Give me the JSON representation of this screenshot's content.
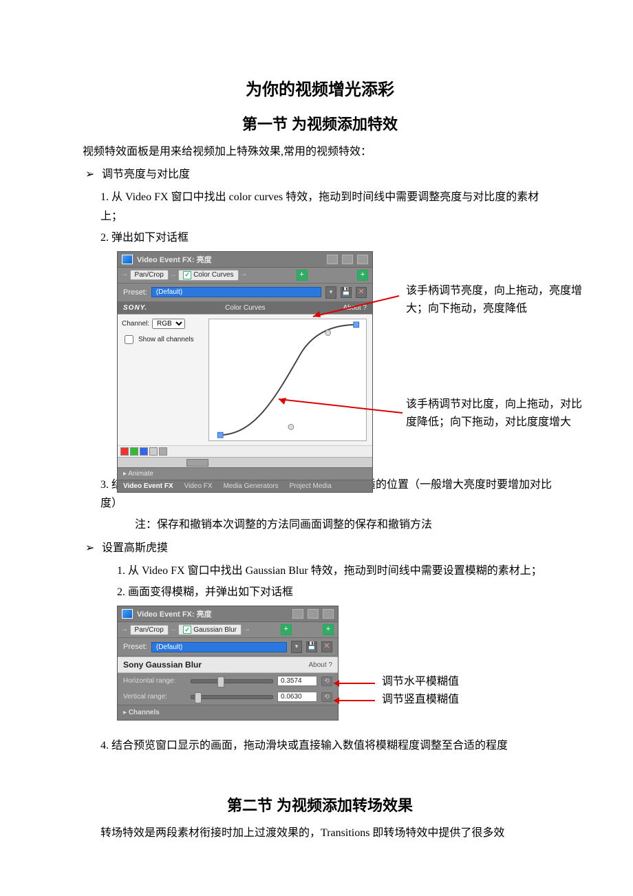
{
  "title": "为你的视频增光添彩",
  "section1": {
    "heading": "第一节  为视频添加特效",
    "intro": "视频特效面板是用来给视频加上特殊效果,常用的视频特效：",
    "bullet1": "调节亮度与对比度",
    "step1": "1. 从 Video FX 窗口中找出 color curves 特效，拖动到时间线中需要调整亮度与对比度的素材上；",
    "step2": "2. 弹出如下对话框",
    "step3": "3. 结合预览窗口显示的画面，将亮度与对比度调整至合适的位置（一般增大亮度时要增加对比度）",
    "note": "注：保存和撤销本次调整的方法同画面调整的保存和撤销方法",
    "bullet2": "设置高斯虎摸",
    "gb_step1": "1.    从 Video FX 窗口中找出 Gaussian Blur 特效，拖动到时间线中需要设置模糊的素材上；",
    "gb_step2": "2.    画面变得模糊，并弹出如下对话框",
    "step4": "4. 结合预览窗口显示的画面，拖动滑块或直接输入数值将模糊程度调整至合适的程度"
  },
  "section2": {
    "heading": "第二节  为视频添加转场效果",
    "intro": "转场特效是两段素材衔接时加上过渡效果的，Transitions 即转场特效中提供了很多效"
  },
  "fx1": {
    "title": "Video Event FX: 亮度",
    "chain": {
      "pan": "Pan/Crop",
      "fx": "Color Curves"
    },
    "preset_label": "Preset:",
    "preset_value": "(Default)",
    "brand": "SONY.",
    "fx_name": "Color Curves",
    "about": "About  ?",
    "channel_label": "Channel:",
    "channel_value": "RGB",
    "show_all": "Show all channels",
    "animate": "Animate",
    "tabs": {
      "a": "Video Event FX",
      "b": "Video FX",
      "c": "Media Generators",
      "d": "Project Media"
    }
  },
  "annot1": {
    "top": "该手柄调节亮度，向上拖动，亮度增大；向下拖动，亮度降低",
    "bottom": "该手柄调节对比度，向上拖动，对比度降低；向下拖动，对比度度增大"
  },
  "fx2": {
    "title": "Video Event FX: 亮度",
    "chain": {
      "pan": "Pan/Crop",
      "fx": "Gaussian Blur"
    },
    "preset_label": "Preset:",
    "preset_value": "(Default)",
    "header": "Sony Gaussian Blur",
    "about": "About  ?",
    "h_label": "Horizontal range:",
    "h_value": "0.3574",
    "v_label": "Vertical range:",
    "v_value": "0.0630",
    "channels": "Channels"
  },
  "annot2": {
    "h": "调节水平模糊值",
    "v": "调节竖直模糊值"
  }
}
